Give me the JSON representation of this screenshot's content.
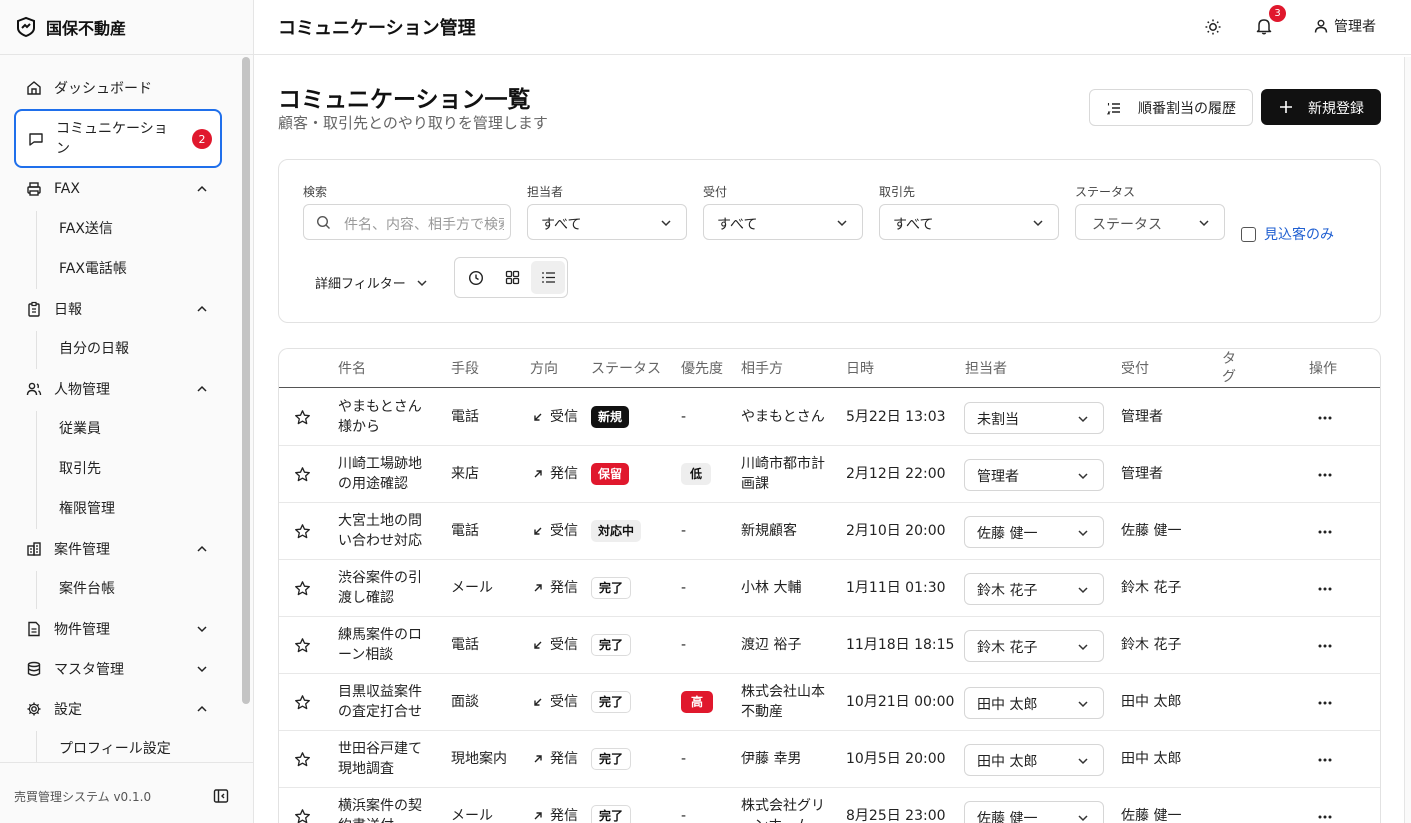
{
  "brand": {
    "name": "国保不動産"
  },
  "sidebar": {
    "items": [
      {
        "label": "ダッシュボード"
      },
      {
        "label": "コミュニケーション",
        "badge": "2"
      },
      {
        "label": "FAX"
      },
      {
        "label": "日報"
      },
      {
        "label": "人物管理"
      },
      {
        "label": "案件管理"
      },
      {
        "label": "物件管理"
      },
      {
        "label": "マスタ管理"
      },
      {
        "label": "設定"
      }
    ],
    "sub": {
      "fax_send": "FAX送信",
      "fax_book": "FAX電話帳",
      "my_report": "自分の日報",
      "employees": "従業員",
      "partners": "取引先",
      "permissions": "権限管理",
      "case_ledger": "案件台帳",
      "profile": "プロフィール設定"
    },
    "version": "売買管理システム v0.1.0"
  },
  "header": {
    "title": "コミュニケーション管理",
    "notif_count": "3",
    "user": "管理者"
  },
  "page": {
    "title": "コミュニケーション一覧",
    "subtitle": "顧客・取引先とのやり取りを管理します",
    "history_button": "順番割当の履歴",
    "new_button": "新規登録"
  },
  "filters": {
    "search_label": "検索",
    "search_placeholder": "件名、内容、相手方で検索",
    "assignee_label": "担当者",
    "assignee_value": "すべて",
    "reception_label": "受付",
    "reception_value": "すべて",
    "partner_label": "取引先",
    "partner_value": "すべて",
    "status_label": "ステータス",
    "status_value": "ステータス",
    "prospect_only": "見込客のみ",
    "advanced": "詳細フィルター"
  },
  "table": {
    "headers": {
      "subject": "件名",
      "method": "手段",
      "direction": "方向",
      "status": "ステータス",
      "priority": "優先度",
      "counterpart": "相手方",
      "datetime": "日時",
      "assignee": "担当者",
      "reception": "受付",
      "tags": "タグ",
      "actions": "操作"
    },
    "rows": [
      {
        "subject": "やまもとさん様から",
        "method": "電話",
        "direction": "受信",
        "status": "新規",
        "priority": "-",
        "counterpart": "やまもとさん",
        "datetime": "5月22日 13:03",
        "assignee": "未割当",
        "reception": "管理者"
      },
      {
        "subject": "川崎工場跡地の用途確認",
        "method": "来店",
        "direction": "発信",
        "status": "保留",
        "priority": "低",
        "counterpart": "川崎市都市計画課",
        "datetime": "2月12日 22:00",
        "assignee": "管理者",
        "reception": "管理者"
      },
      {
        "subject": "大宮土地の問い合わせ対応",
        "method": "電話",
        "direction": "受信",
        "status": "対応中",
        "priority": "-",
        "counterpart": "新規顧客",
        "datetime": "2月10日 20:00",
        "assignee": "佐藤 健一",
        "reception": "佐藤 健一"
      },
      {
        "subject": "渋谷案件の引渡し確認",
        "method": "メール",
        "direction": "発信",
        "status": "完了",
        "priority": "-",
        "counterpart": "小林 大輔",
        "datetime": "1月11日 01:30",
        "assignee": "鈴木 花子",
        "reception": "鈴木 花子"
      },
      {
        "subject": "練馬案件のローン相談",
        "method": "電話",
        "direction": "受信",
        "status": "完了",
        "priority": "-",
        "counterpart": "渡辺 裕子",
        "datetime": "11月18日 18:15",
        "assignee": "鈴木 花子",
        "reception": "鈴木 花子"
      },
      {
        "subject": "目黒収益案件の査定打合せ",
        "method": "面談",
        "direction": "受信",
        "status": "完了",
        "priority": "高",
        "counterpart": "株式会社山本不動産",
        "datetime": "10月21日 00:00",
        "assignee": "田中 太郎",
        "reception": "田中 太郎"
      },
      {
        "subject": "世田谷戸建て現地調査",
        "method": "現地案内",
        "direction": "発信",
        "status": "完了",
        "priority": "-",
        "counterpart": "伊藤 幸男",
        "datetime": "10月5日 20:00",
        "assignee": "田中 太郎",
        "reception": "田中 太郎"
      },
      {
        "subject": "横浜案件の契約書送付",
        "method": "メール",
        "direction": "発信",
        "status": "完了",
        "priority": "-",
        "counterpart": "株式会社グリーンホーム",
        "datetime": "8月25日 23:00",
        "assignee": "佐藤 健一",
        "reception": "佐藤 健一"
      }
    ]
  },
  "colors": {
    "accent": "#1f6feb",
    "danger": "#e0182d",
    "dark": "#111111"
  }
}
